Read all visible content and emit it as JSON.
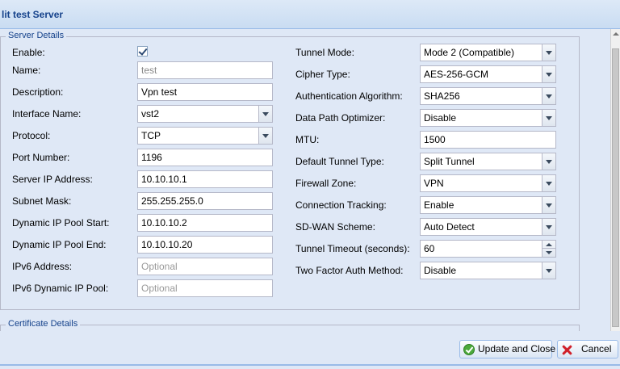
{
  "window": {
    "title": "lit test Server"
  },
  "server_details": {
    "legend": "Server Details",
    "left": {
      "enable": {
        "label": "Enable:",
        "checked": true
      },
      "name": {
        "label": "Name:",
        "value": "test"
      },
      "description": {
        "label": "Description:",
        "value": "Vpn test"
      },
      "interface_name": {
        "label": "Interface Name:",
        "value": "vst2"
      },
      "protocol": {
        "label": "Protocol:",
        "value": "TCP"
      },
      "port_number": {
        "label": "Port Number:",
        "value": "1196"
      },
      "server_ip": {
        "label": "Server IP Address:",
        "value": "10.10.10.1"
      },
      "subnet_mask": {
        "label": "Subnet Mask:",
        "value": "255.255.255.0"
      },
      "pool_start": {
        "label": "Dynamic IP Pool Start:",
        "value": "10.10.10.2"
      },
      "pool_end": {
        "label": "Dynamic IP Pool End:",
        "value": "10.10.10.20"
      },
      "ipv6_address": {
        "label": "IPv6 Address:",
        "placeholder": "Optional"
      },
      "ipv6_pool": {
        "label": "IPv6 Dynamic IP Pool:",
        "placeholder": "Optional"
      }
    },
    "right": {
      "tunnel_mode": {
        "label": "Tunnel Mode:",
        "value": "Mode 2 (Compatible)"
      },
      "cipher_type": {
        "label": "Cipher Type:",
        "value": "AES-256-GCM"
      },
      "auth_algorithm": {
        "label": "Authentication Algorithm:",
        "value": "SHA256"
      },
      "data_path_optimizer": {
        "label": "Data Path Optimizer:",
        "value": "Disable"
      },
      "mtu": {
        "label": "MTU:",
        "value": "1500"
      },
      "default_tunnel_type": {
        "label": "Default Tunnel Type:",
        "value": "Split Tunnel"
      },
      "firewall_zone": {
        "label": "Firewall Zone:",
        "value": "VPN"
      },
      "connection_tracking": {
        "label": "Connection Tracking:",
        "value": "Enable"
      },
      "sdwan_scheme": {
        "label": "SD-WAN Scheme:",
        "value": "Auto Detect"
      },
      "tunnel_timeout": {
        "label": "Tunnel Timeout (seconds):",
        "value": "60"
      },
      "two_factor": {
        "label": "Two Factor Auth Method:",
        "value": "Disable"
      }
    }
  },
  "certificate_details": {
    "legend": "Certificate Details"
  },
  "footer": {
    "update_label": "Update and Close",
    "cancel_label": "Cancel"
  },
  "icons": {
    "update": "check-circle-icon",
    "cancel": "close-x-icon",
    "enable_checkbox": "checkbox-checked-icon"
  }
}
